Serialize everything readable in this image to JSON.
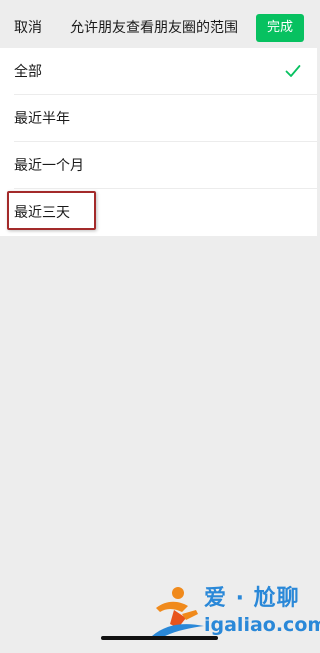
{
  "header": {
    "cancel_label": "取消",
    "title": "允许朋友查看朋友圈的范围",
    "done_label": "完成"
  },
  "options": [
    {
      "label": "全部",
      "selected": true
    },
    {
      "label": "最近半年",
      "selected": false
    },
    {
      "label": "最近一个月",
      "selected": false
    },
    {
      "label": "最近三天",
      "selected": false
    }
  ],
  "watermark": {
    "cn_text": "爱 · 尬聊",
    "url_text": "igaliao.com"
  },
  "colors": {
    "accent": "#07c160",
    "background": "#ededed",
    "highlight_border": "#a32a2a",
    "watermark": "#2a88d8"
  }
}
